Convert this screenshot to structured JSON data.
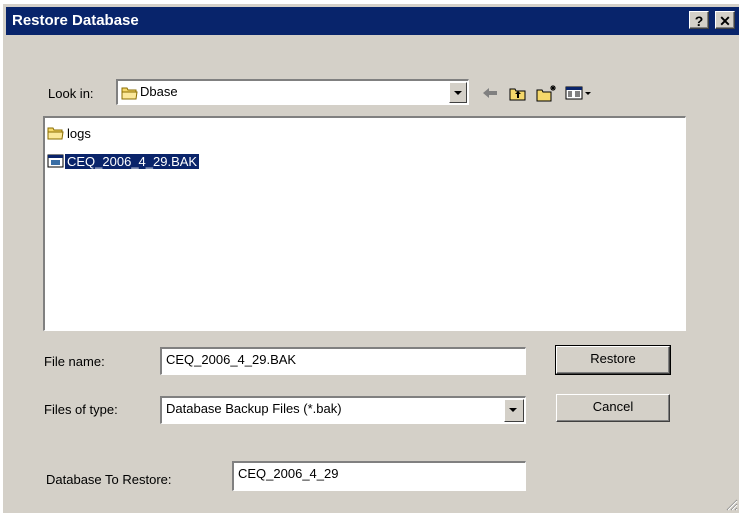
{
  "window": {
    "title": "Restore Database",
    "help_glyph": "?",
    "close_glyph": "✕"
  },
  "lookin": {
    "label": "Look in:",
    "value": "Dbase"
  },
  "toolbar_icons": [
    "back-arrow-icon",
    "up-folder-icon",
    "new-folder-icon",
    "view-menu-icon"
  ],
  "files": [
    {
      "name": "logs",
      "icon": "folder-icon",
      "selected": false
    },
    {
      "name": "CEQ_2006_4_29.BAK",
      "icon": "backup-file-icon",
      "selected": true
    }
  ],
  "filename": {
    "label": "File name:",
    "value": "CEQ_2006_4_29.BAK"
  },
  "filetype": {
    "label": "Files of type:",
    "value": "Database Backup Files (*.bak)"
  },
  "dbrestore": {
    "label": "Database To Restore:",
    "value": "CEQ_2006_4_29"
  },
  "buttons": {
    "restore": "Restore",
    "cancel": "Cancel"
  },
  "colors": {
    "titlebar": "#08246b",
    "face": "#d4d0c8",
    "selection": "#0a246a",
    "folder": "#f5d86b"
  }
}
